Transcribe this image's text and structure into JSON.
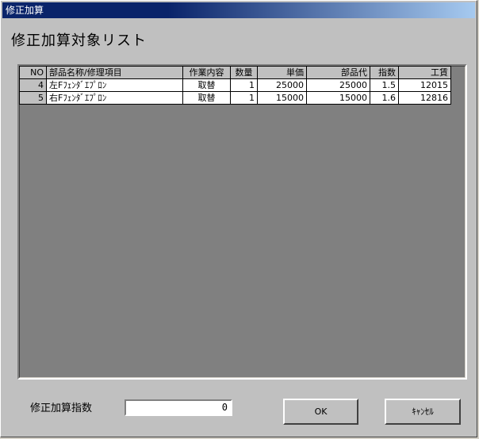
{
  "window": {
    "title": "修正加算"
  },
  "heading": "修正加算対象リスト",
  "table": {
    "columns": [
      "NO",
      "部品名称/修理項目",
      "作業内容",
      "数量",
      "単価",
      "部品代",
      "指数",
      "工賃"
    ],
    "rows": [
      [
        "4",
        "左Fﾌｪﾝﾀﾞｴﾌﾟﾛﾝ",
        "取替",
        "1",
        "25000",
        "25000",
        "1.5",
        "12015"
      ],
      [
        "5",
        "右Fﾌｪﾝﾀﾞｴﾌﾟﾛﾝ",
        "取替",
        "1",
        "15000",
        "15000",
        "1.6",
        "12816"
      ]
    ]
  },
  "form": {
    "index_label": "修正加算指数",
    "index_value": "0"
  },
  "buttons": {
    "ok": "OK",
    "cancel": "ｷｬﾝｾﾙ"
  }
}
